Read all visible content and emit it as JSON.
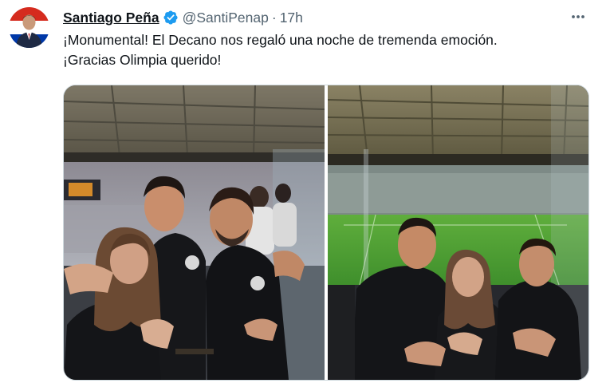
{
  "author": {
    "name": "Santiago Peña",
    "handle": "@SantiPenap",
    "separator": "·",
    "time": "17h",
    "verified": true
  },
  "tweet": {
    "lines": [
      "¡Monumental! El Decano nos regaló una noche de tremenda emoción.",
      "¡Gracias Olimpia querido!"
    ]
  },
  "media": {
    "count": 2,
    "photos": [
      "stadium-box-group-photo",
      "stadium-selfie-photo"
    ]
  },
  "icons": {
    "verified": "verified-badge-icon",
    "more": "more-options-icon"
  },
  "colors": {
    "verified_blue": "#1d9bf0",
    "secondary_text": "#536471",
    "border": "#cfd9de",
    "paraguay_red": "#d52b1e",
    "paraguay_blue": "#0038a8"
  }
}
